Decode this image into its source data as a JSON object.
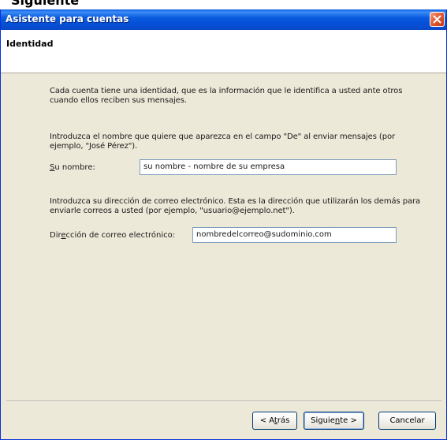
{
  "top_caption": "Siguiente",
  "window": {
    "title": "Asistente para cuentas"
  },
  "header": {
    "title": "Identidad"
  },
  "body": {
    "paragraph1": "Cada cuenta tiene una identidad, que es la información que le identifica a usted ante otros cuando ellos reciben sus mensajes.",
    "paragraph2": "Introduzca el nombre que quiere que aparezca en el campo \"De\" al enviar mensajes (por ejemplo, \"José Pérez\").",
    "paragraph3": "Introduzca su dirección de correo electrónico. Esta es la dirección que utilizarán los demás para enviarle correos a usted (por ejemplo, \"usuario@ejemplo.net\")."
  },
  "form": {
    "name_label": "Su nombre:",
    "name_value": "su nombre - nombre de su empresa",
    "email_label": "Dirección de correo electrónico:",
    "email_value": "nombredelcorreo@sudominio.com"
  },
  "buttons": {
    "back": "< Atrás",
    "next": "Siguiente >",
    "cancel": "Cancelar"
  },
  "colors": {
    "titlebar": "#0a5bdf",
    "dialog_background": "#ece9d8",
    "close_button": "#e25d36",
    "input_border": "#7f9db9"
  }
}
